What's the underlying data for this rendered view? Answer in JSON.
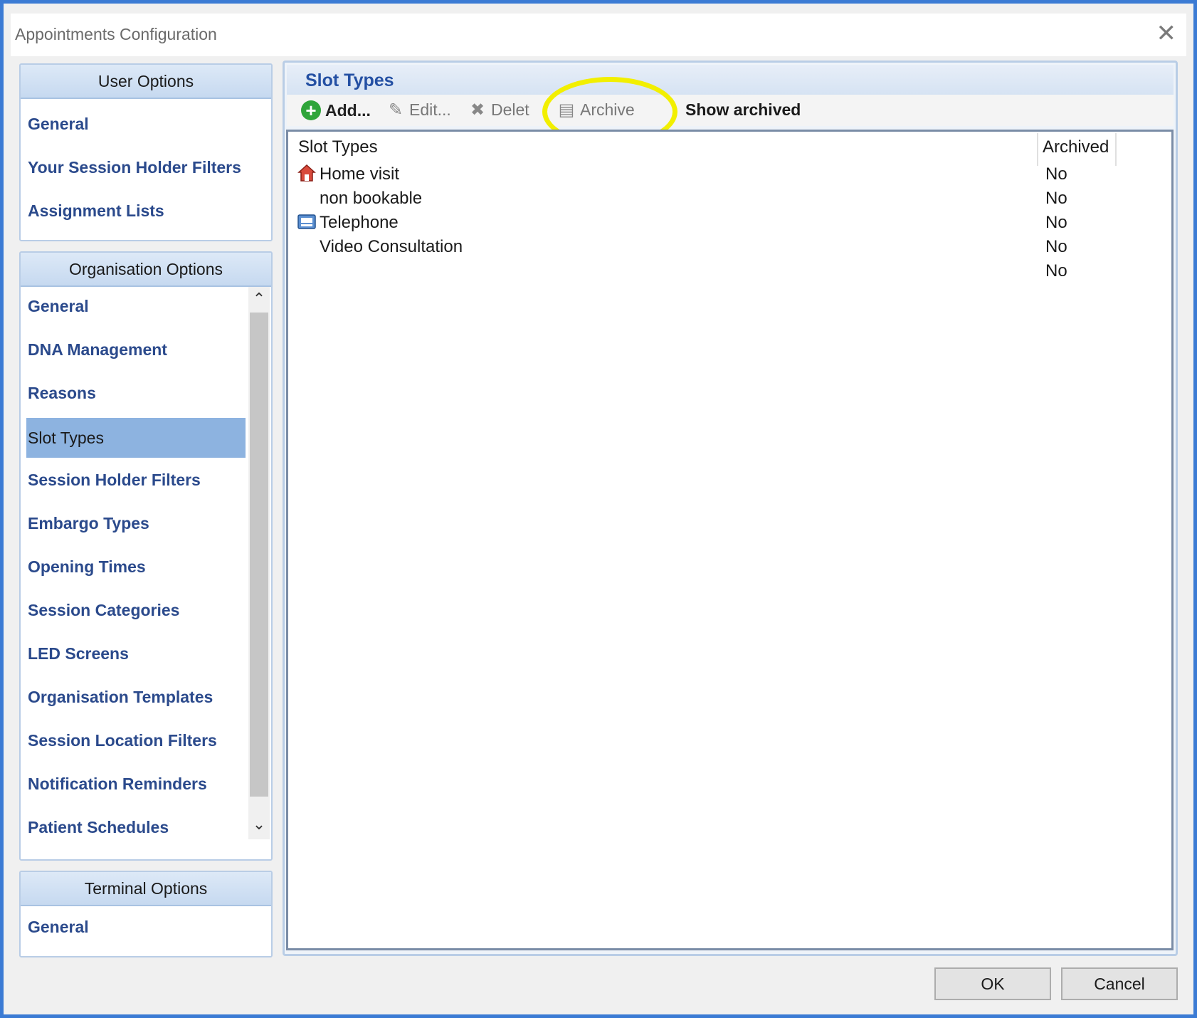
{
  "window": {
    "title": "Appointments Configuration"
  },
  "user_options": {
    "header": "User Options",
    "items": [
      "General",
      "Your Session Holder Filters",
      "Assignment Lists"
    ]
  },
  "organisation_options": {
    "header": "Organisation Options",
    "items": [
      "General",
      "DNA Management",
      "Reasons",
      "Slot Types",
      "Session Holder Filters",
      "Embargo Types",
      "Opening Times",
      "Session Categories",
      "LED Screens",
      "Organisation Templates",
      "Session Location Filters",
      "Notification Reminders",
      "Patient Schedules"
    ],
    "selected": "Slot Types"
  },
  "terminal_options": {
    "header": "Terminal Options",
    "items": [
      "General"
    ]
  },
  "content": {
    "title": "Slot Types",
    "toolbar": {
      "add": "Add...",
      "edit": "Edit...",
      "delete": "Delet",
      "archive": "Archive",
      "show_archived": "Show archived"
    },
    "grid": {
      "columns": [
        "Slot Types",
        "Archived"
      ],
      "rows": [
        {
          "name": "Home visit",
          "archived": "No",
          "icon": "home-visit-icon"
        },
        {
          "name": "non bookable",
          "archived": "No",
          "icon": ""
        },
        {
          "name": "Telephone",
          "archived": "No",
          "icon": "telephone-icon"
        },
        {
          "name": "Video Consultation",
          "archived": "No",
          "icon": ""
        },
        {
          "name": "",
          "archived": "No",
          "icon": ""
        }
      ]
    }
  },
  "footer": {
    "ok": "OK",
    "cancel": "Cancel"
  },
  "colors": {
    "link": "#2b4a8c",
    "selected_bg": "#8db3e0",
    "highlight": "#f2ef00",
    "add_green": "#2fa53a"
  }
}
